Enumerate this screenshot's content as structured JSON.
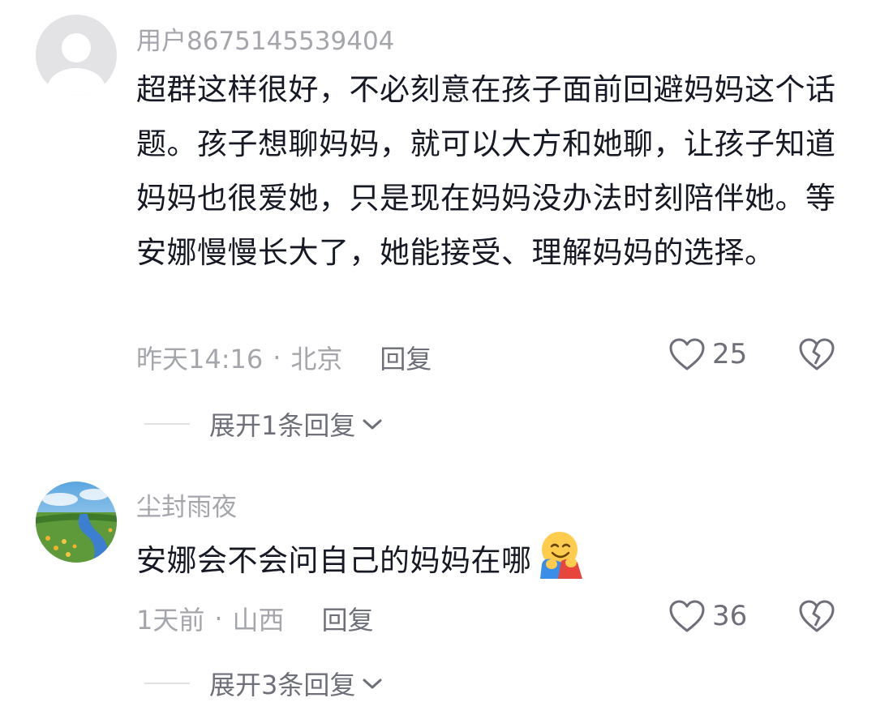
{
  "comments": [
    {
      "username": "用户8675145539404",
      "text": "超群这样很好，不必刻意在孩子面前回避妈妈这个话题。孩子想聊妈妈，就可以大方和她聊，让孩子知道妈妈也很爱她，只是现在妈妈没办法时刻陪伴她。等安娜慢慢长大了，她能接受、理解妈妈的选择。",
      "time": "昨天14:16",
      "location": "北京",
      "reply_label": "回复",
      "likes": "25",
      "expand_label": "展开1条回复",
      "avatar": "default-avatar"
    },
    {
      "username": "尘封雨夜",
      "text": "安娜会不会问自己的妈妈在哪",
      "emoji": "hugging-face",
      "time": "1天前",
      "location": "山西",
      "reply_label": "回复",
      "likes": "36",
      "expand_label": "展开3条回复",
      "avatar": "landscape-river-photo"
    }
  ],
  "separator": "·",
  "colors": {
    "text": "#161823",
    "secondary": "#a5a6ab",
    "action": "#6e6f78",
    "divider": "#e2e2e4"
  }
}
